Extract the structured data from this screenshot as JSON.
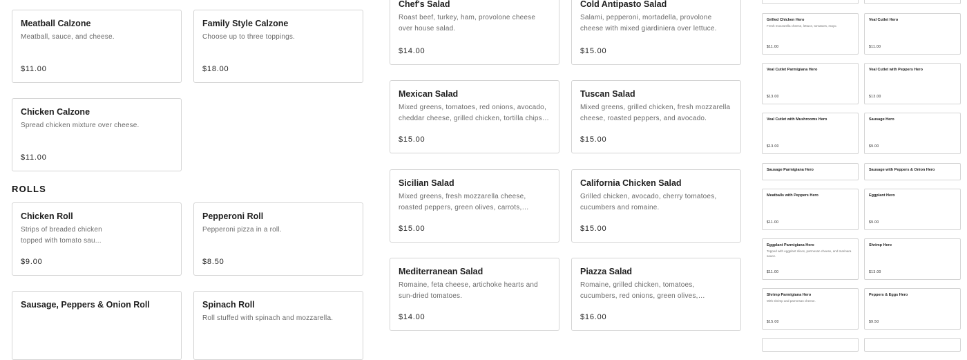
{
  "left": {
    "calzones": [
      {
        "name": "Meatball Calzone",
        "desc": "Meatball, sauce, and cheese.",
        "price": "$11.00"
      },
      {
        "name": "Family Style Calzone",
        "desc": "Choose up to three toppings.",
        "price": "$18.00"
      },
      {
        "name": "Chicken Calzone",
        "desc": "Spread chicken mixture over cheese.",
        "price": "$11.00"
      }
    ],
    "rolls_title": "ROLLS",
    "rolls": [
      {
        "name": "Chicken Roll",
        "desc": "Strips of breaded chicken topped with tomato sau...",
        "price": "$9.00"
      },
      {
        "name": "Pepperoni Roll",
        "desc": "Pepperoni pizza in a roll.",
        "price": "$8.50"
      },
      {
        "name": "Sausage, Peppers & Onion Roll",
        "desc": "",
        "price": ""
      },
      {
        "name": "Spinach Roll",
        "desc": "Roll stuffed with spinach and mozzarella.",
        "price": ""
      }
    ]
  },
  "salads": [
    {
      "name": "Chef's Salad",
      "desc": "Roast beef, turkey, ham, provolone cheese over house salad.",
      "price": "$14.00"
    },
    {
      "name": "Cold Antipasto Salad",
      "desc": "Salami, pepperoni, mortadella, provolone cheese with mixed giardiniera over lettuce.",
      "price": "$15.00"
    },
    {
      "name": "Mexican Salad",
      "desc": "Mixed greens, tomatoes, red onions, avocado, cheddar cheese, grilled chicken, tortilla chips a...",
      "price": "$15.00"
    },
    {
      "name": "Tuscan Salad",
      "desc": "Mixed greens, grilled chicken, fresh mozzarella cheese, roasted peppers, and avocado.",
      "price": "$15.00"
    },
    {
      "name": "Sicilian Salad",
      "desc": "Mixed greens, fresh mozzarella cheese, roasted peppers, green olives, carrots, tomatoes,...",
      "price": "$15.00"
    },
    {
      "name": "California Chicken Salad",
      "desc": "Grilled chicken, avocado, cherry tomatoes, cucumbers and romaine.",
      "price": "$15.00"
    },
    {
      "name": "Mediterranean Salad",
      "desc": "Romaine, feta cheese, artichoke hearts and sun-dried tomatoes.",
      "price": "$14.00"
    },
    {
      "name": "Piazza Salad",
      "desc": "Romaine, grilled chicken, tomatoes, cucumbers, red onions, green olives, cranberries, nuts,...",
      "price": "$16.00"
    }
  ],
  "heroes": [
    {
      "name": "Grilled Chicken Hero",
      "desc": "Fresh mozzarella cheese, lettuce, tomatoes, mayo.",
      "price": "$11.00"
    },
    {
      "name": "Veal Cutlet Hero",
      "desc": "",
      "price": "$11.00"
    },
    {
      "name": "Veal Cutlet Parmigiana Hero",
      "desc": "",
      "price": "$13.00"
    },
    {
      "name": "Veal Cutlet with Peppers Hero",
      "desc": "",
      "price": "$13.00"
    },
    {
      "name": "Veal Cutlet with Mushrooms Hero",
      "desc": "",
      "price": "$13.00"
    },
    {
      "name": "Sausage Hero",
      "desc": "",
      "price": "$9.00"
    },
    {
      "name": "Sausage Parmigiana Hero",
      "desc": "",
      "price": ""
    },
    {
      "name": "Sausage with Peppers & Onion Hero",
      "desc": "",
      "price": ""
    },
    {
      "name": "Meatballs with Peppers Hero",
      "desc": "",
      "price": "$11.00"
    },
    {
      "name": "Eggplant Hero",
      "desc": "",
      "price": "$9.00"
    },
    {
      "name": "Eggplant Parmigiana Hero",
      "desc": "Topped with eggplant slices, parmesan cheese, and marinara sauce.",
      "price": "$11.00"
    },
    {
      "name": "Shrimp Hero",
      "desc": "",
      "price": "$13.00"
    },
    {
      "name": "Shrimp Parmigiana Hero",
      "desc": "With shrimp and parmesan cheese.",
      "price": "$15.00"
    },
    {
      "name": "Peppers & Eggs Hero",
      "desc": "",
      "price": "$9.50"
    }
  ]
}
